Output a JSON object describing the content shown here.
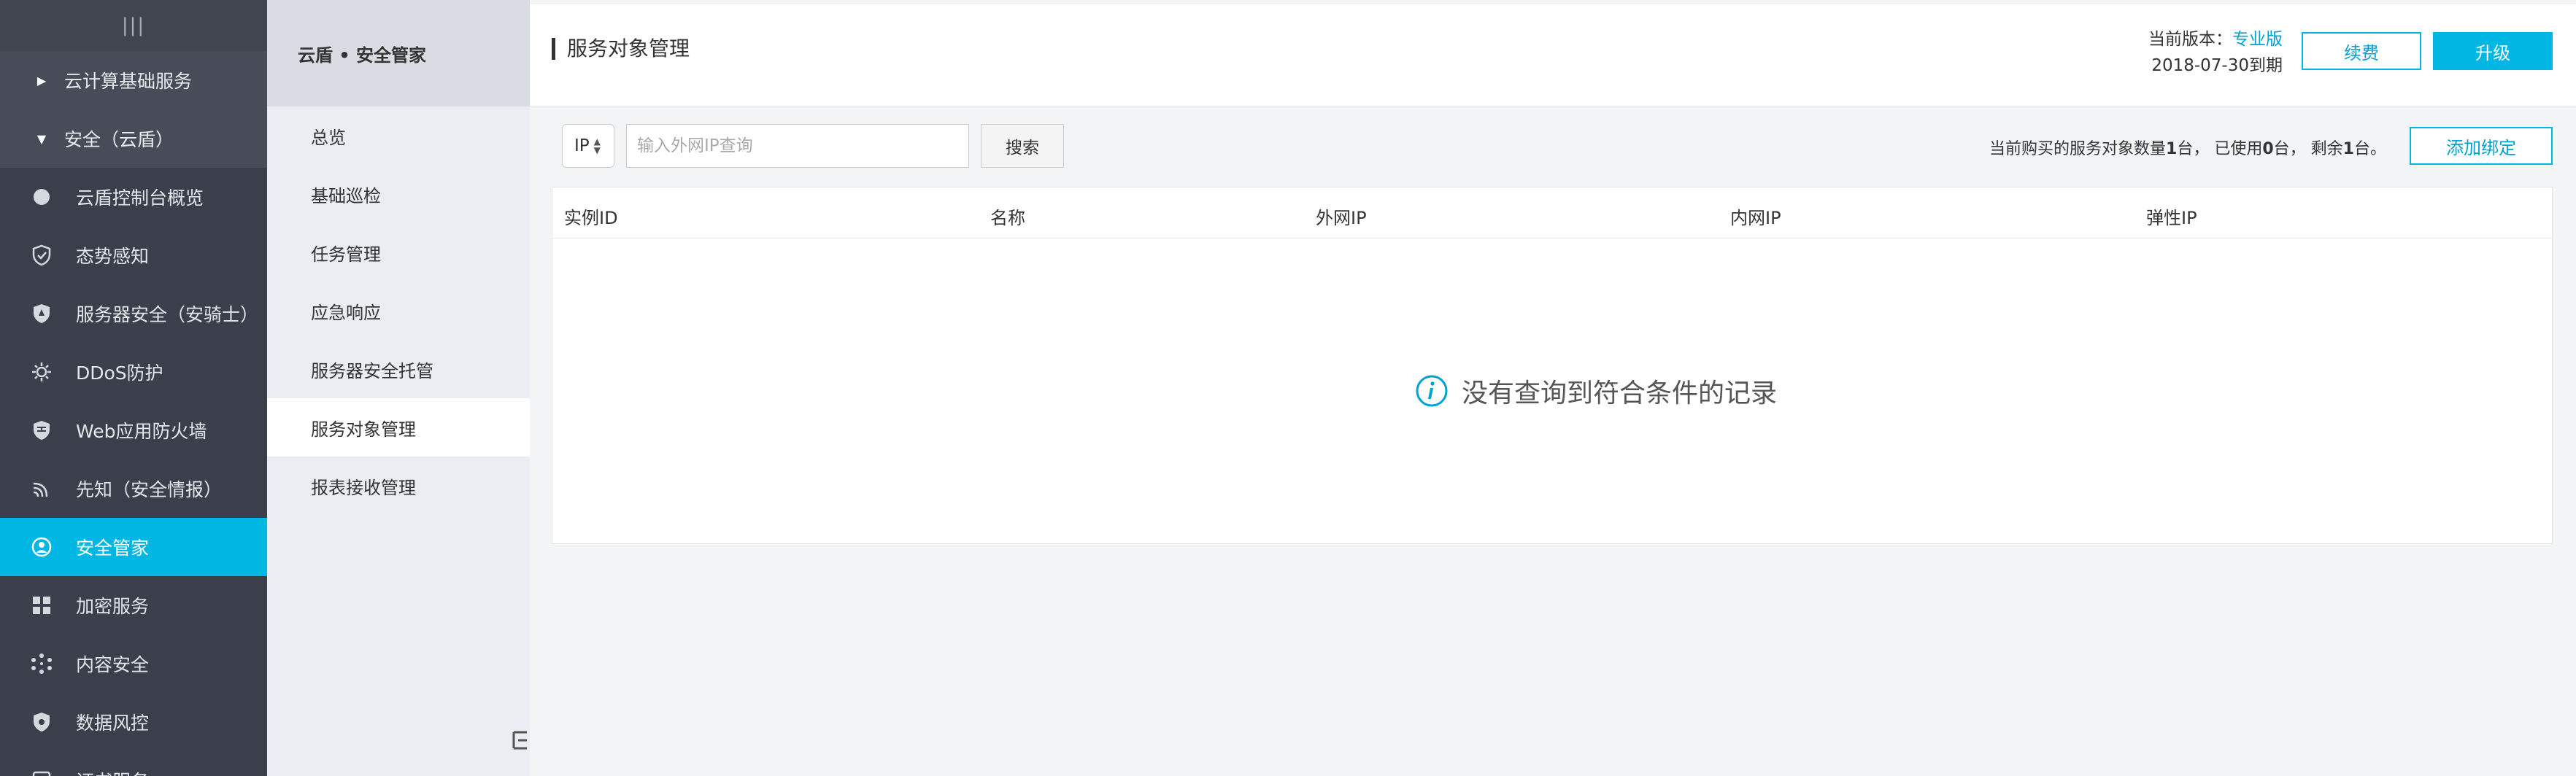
{
  "sidebar": {
    "toggle": "|||",
    "groups": [
      {
        "label": "云计算基础服务",
        "expanded": false
      },
      {
        "label": "安全（云盾）",
        "expanded": true
      }
    ],
    "items": [
      {
        "label": "云盾控制台概览",
        "icon": "circle-dot-icon"
      },
      {
        "label": "态势感知",
        "icon": "shield-check-icon"
      },
      {
        "label": "服务器安全（安骑士）",
        "icon": "shield-knight-icon"
      },
      {
        "label": "DDoS防护",
        "icon": "gear-sun-icon"
      },
      {
        "label": "Web应用防火墙",
        "icon": "firewall-shield-icon"
      },
      {
        "label": "先知（安全情报）",
        "icon": "signal-icon"
      },
      {
        "label": "安全管家",
        "icon": "butler-icon"
      },
      {
        "label": "加密服务",
        "icon": "encryption-grid-icon"
      },
      {
        "label": "内容安全",
        "icon": "network-nodes-icon"
      },
      {
        "label": "数据风控",
        "icon": "shield-lock-icon"
      },
      {
        "label": "证书服务",
        "icon": "certificate-icon"
      }
    ]
  },
  "subnav": {
    "title": "云盾 • 安全管家",
    "items": [
      "总览",
      "基础巡检",
      "任务管理",
      "应急响应",
      "服务器安全托管",
      "服务对象管理",
      "报表接收管理"
    ]
  },
  "header": {
    "title": "服务对象管理",
    "version_label": "当前版本：",
    "edition": "专业版",
    "expiry": "2018-07-30到期",
    "renew_label": "续费",
    "upgrade_label": "升级"
  },
  "toolbar": {
    "filter_type": "IP",
    "search_placeholder": "输入外网IP查询",
    "search_label": "搜索",
    "quota_prefix": "当前购买的服务对象数量",
    "quota_total": "1",
    "quota_mid1": "台，  已使用",
    "quota_used": "0",
    "quota_mid2": "台，  剩余",
    "quota_left": "1",
    "quota_suffix": "台。",
    "add_bind_label": "添加绑定"
  },
  "table": {
    "columns": [
      "实例ID",
      "名称",
      "外网IP",
      "内网IP",
      "弹性IP"
    ],
    "rows": [],
    "empty_text": "没有查询到符合条件的记录"
  },
  "colors": {
    "accent": "#00b7e4",
    "sidebar_bg": "#3a3f4b",
    "subnav_bg": "#eaedf1"
  }
}
